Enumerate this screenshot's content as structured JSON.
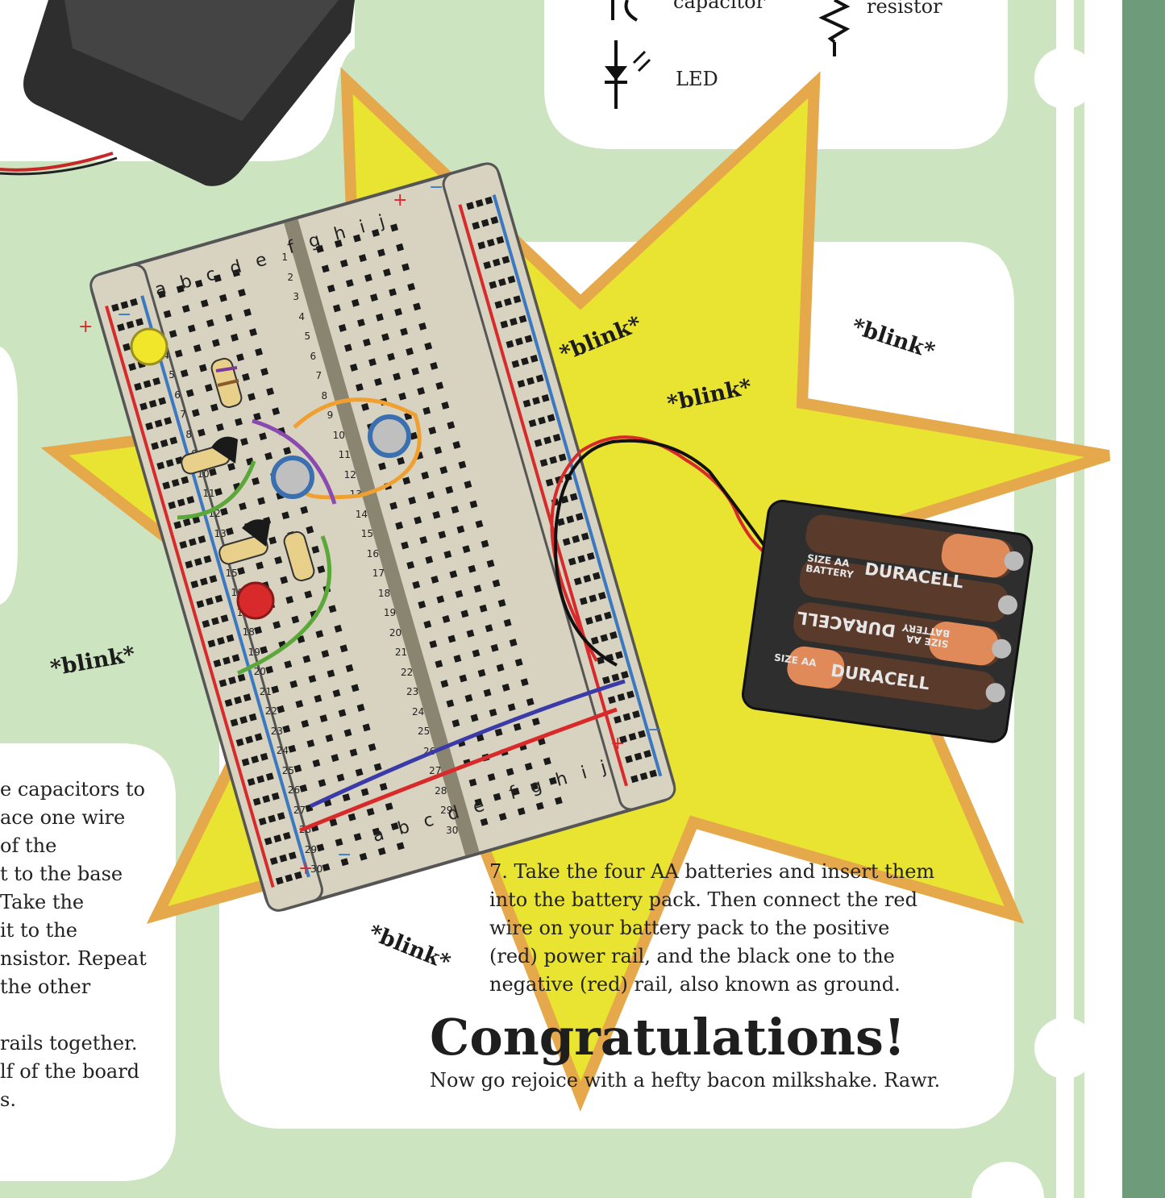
{
  "legend": {
    "capacitor_label": "capacitor",
    "resistor_label": "resistor",
    "led_label": "LED"
  },
  "blinks": [
    "*blink*",
    "*blink*",
    "*blink*",
    "*blink*",
    "*blink*"
  ],
  "breadboard": {
    "left_columns": "a b c d e",
    "right_columns": "f g h i j",
    "rail_plus": "+",
    "rail_minus": "−",
    "row_numbers": [
      "1",
      "2",
      "3",
      "4",
      "5",
      "6",
      "7",
      "8",
      "9",
      "10",
      "11",
      "12",
      "13",
      "14",
      "15",
      "16",
      "17",
      "18",
      "19",
      "20",
      "21",
      "22",
      "23",
      "24",
      "25",
      "26",
      "27",
      "28",
      "29",
      "30"
    ]
  },
  "battery_pack": {
    "brand": "DURACELL",
    "size_label_line1": "SIZE AA",
    "size_label_line2": "BATTERY",
    "size_label_short": "SIZE AA"
  },
  "left_text_lines": [
    "e capacitors to",
    "ace one wire",
    "of the",
    "t to the base",
    " Take the",
    " it to the",
    "nsistor. Repeat",
    " the other",
    "",
    "rails together.",
    "lf of the board",
    "s."
  ],
  "step7_lines": [
    "7. Take the four AA batteries and insert them",
    "into the battery pack. Then connect the red",
    "wire on your battery pack to the positive",
    "(red) power rail, and the black one to the",
    "negative (red) rail, also known as ground."
  ],
  "congrats_title": "Congratulations!",
  "congrats_subtitle": "Now go rejoice with a hefty bacon milkshake. Rawr.",
  "colors": {
    "background": "#cde4c0",
    "starburst_fill": "#e9e432",
    "starburst_outline": "#e5a84a",
    "sidebar": "#6e9c7a",
    "breadboard": "#d8d2c0",
    "rail_red": "#d82a2a",
    "rail_blue": "#3a78c2"
  }
}
